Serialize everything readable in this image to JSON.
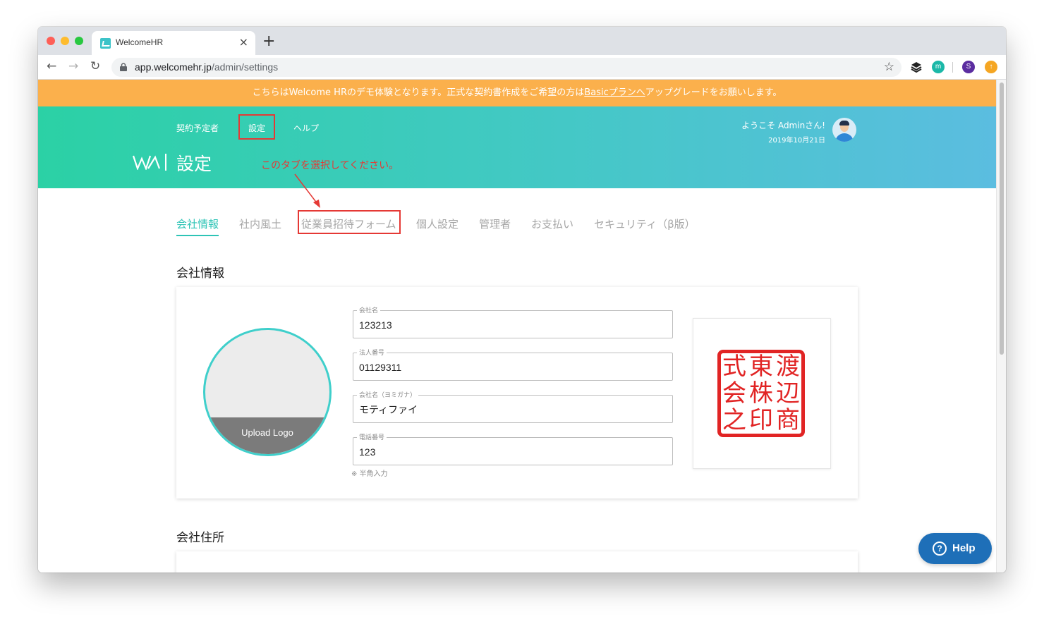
{
  "browser": {
    "tab_title": "WelcomeHR",
    "url_host": "app.welcomehr.jp",
    "url_path": "/admin/settings",
    "extensions": [
      "layers-icon",
      "m",
      "S",
      "upgrade-icon"
    ]
  },
  "banner": {
    "text_before": "こちらはWelcome HRのデモ体験となります。正式な契約書作成をご希望の方は",
    "link": "Basicプランへ",
    "text_after": "アップグレードをお願いします。"
  },
  "header": {
    "nav": [
      "契約予定者",
      "設定",
      "ヘルプ"
    ],
    "title": "設定",
    "annotation": "このタブを選択してください。",
    "welcome": "ようこそ Adminさん!",
    "date": "2019年10月21日"
  },
  "tabs": [
    "会社情報",
    "社内風土",
    "従業員招待フォーム",
    "個人設定",
    "管理者",
    "お支払い",
    "セキュリティ（β版）"
  ],
  "sections": {
    "company_info": "会社情報",
    "company_address": "会社住所"
  },
  "form": {
    "upload_label": "Upload Logo",
    "fields": [
      {
        "label": "会社名",
        "value": "123213"
      },
      {
        "label": "法人番号",
        "value": "01129311"
      },
      {
        "label": "会社名（ヨミガナ）",
        "value": "モティファイ"
      },
      {
        "label": "電話番号",
        "value": "123"
      }
    ],
    "note": "※ 半角入力",
    "seal_chars": [
      "式",
      "東",
      "渡",
      "会",
      "株",
      "辺",
      "之",
      "印",
      "商"
    ]
  },
  "help_button": "Help",
  "colors": {
    "banner": "#fbb04c",
    "accent": "#2ec4b6",
    "annotation": "#e53935",
    "help": "#1e6fb8",
    "seal": "#e12424"
  }
}
